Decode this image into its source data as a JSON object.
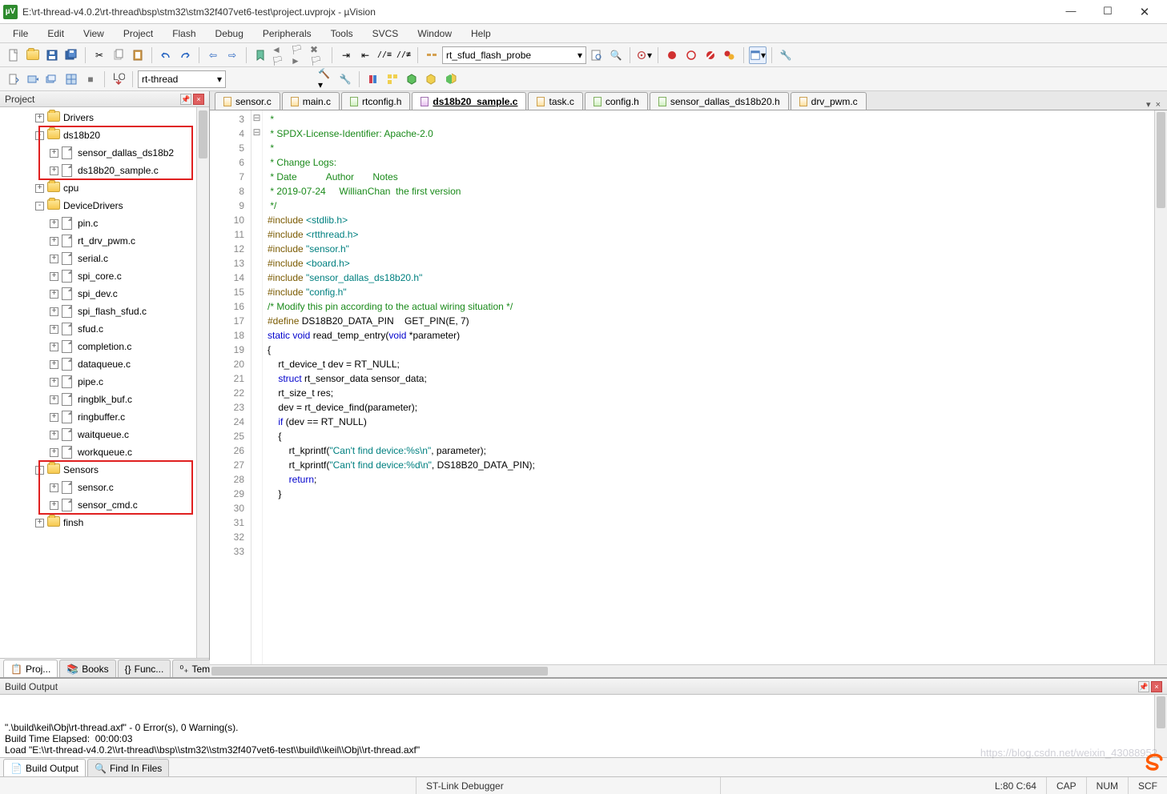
{
  "window": {
    "title": "E:\\rt-thread-v4.0.2\\rt-thread\\bsp\\stm32\\stm32f407vet6-test\\project.uvprojx - µVision",
    "app_icon_label": "µV"
  },
  "menu": [
    "File",
    "Edit",
    "View",
    "Project",
    "Flash",
    "Debug",
    "Peripherals",
    "Tools",
    "SVCS",
    "Window",
    "Help"
  ],
  "toolbar1": {
    "combo": "rt_sfud_flash_probe"
  },
  "toolbar2": {
    "target_combo": "rt-thread"
  },
  "project_panel": {
    "title": "Project",
    "tree": [
      {
        "indent": 2,
        "type": "folder",
        "twist": "+",
        "label": "Drivers"
      },
      {
        "indent": 2,
        "type": "folder",
        "twist": "-",
        "label": "ds18b20",
        "hl": "g1"
      },
      {
        "indent": 3,
        "type": "file",
        "twist": "+",
        "label": "sensor_dallas_ds18b2",
        "hl": "g1"
      },
      {
        "indent": 3,
        "type": "file",
        "twist": "+",
        "label": "ds18b20_sample.c",
        "hl": "g1"
      },
      {
        "indent": 2,
        "type": "folder",
        "twist": "+",
        "label": "cpu"
      },
      {
        "indent": 2,
        "type": "folder",
        "twist": "-",
        "label": "DeviceDrivers"
      },
      {
        "indent": 3,
        "type": "file",
        "twist": "+",
        "label": "pin.c"
      },
      {
        "indent": 3,
        "type": "file",
        "twist": "+",
        "label": "rt_drv_pwm.c"
      },
      {
        "indent": 3,
        "type": "file",
        "twist": "+",
        "label": "serial.c"
      },
      {
        "indent": 3,
        "type": "file",
        "twist": "+",
        "label": "spi_core.c"
      },
      {
        "indent": 3,
        "type": "file",
        "twist": "+",
        "label": "spi_dev.c"
      },
      {
        "indent": 3,
        "type": "file",
        "twist": "+",
        "label": "spi_flash_sfud.c"
      },
      {
        "indent": 3,
        "type": "file",
        "twist": "+",
        "label": "sfud.c"
      },
      {
        "indent": 3,
        "type": "file",
        "twist": "+",
        "label": "completion.c"
      },
      {
        "indent": 3,
        "type": "file",
        "twist": "+",
        "label": "dataqueue.c"
      },
      {
        "indent": 3,
        "type": "file",
        "twist": "+",
        "label": "pipe.c"
      },
      {
        "indent": 3,
        "type": "file",
        "twist": "+",
        "label": "ringblk_buf.c"
      },
      {
        "indent": 3,
        "type": "file",
        "twist": "+",
        "label": "ringbuffer.c"
      },
      {
        "indent": 3,
        "type": "file",
        "twist": "+",
        "label": "waitqueue.c"
      },
      {
        "indent": 3,
        "type": "file",
        "twist": "+",
        "label": "workqueue.c"
      },
      {
        "indent": 2,
        "type": "folder",
        "twist": "-",
        "label": "Sensors",
        "hl": "g2"
      },
      {
        "indent": 3,
        "type": "file",
        "twist": "+",
        "label": "sensor.c",
        "hl": "g2"
      },
      {
        "indent": 3,
        "type": "file",
        "twist": "+",
        "label": "sensor_cmd.c",
        "hl": "g2"
      },
      {
        "indent": 2,
        "type": "folder",
        "twist": "+",
        "label": "finsh"
      }
    ],
    "bottom_tabs": [
      {
        "label": "Proj...",
        "active": true,
        "icon": "project"
      },
      {
        "label": "Books",
        "active": false,
        "icon": "books"
      },
      {
        "label": "Func...",
        "active": false,
        "icon": "func"
      },
      {
        "label": "Tem...",
        "active": false,
        "icon": "tmpl"
      }
    ]
  },
  "editor_tabs": [
    {
      "label": "sensor.c",
      "cls": "c"
    },
    {
      "label": "main.c",
      "cls": "c"
    },
    {
      "label": "rtconfig.h",
      "cls": "h"
    },
    {
      "label": "ds18b20_sample.c",
      "cls": "sel",
      "active": true
    },
    {
      "label": "task.c",
      "cls": "c"
    },
    {
      "label": "config.h",
      "cls": "h"
    },
    {
      "label": "sensor_dallas_ds18b20.h",
      "cls": "h"
    },
    {
      "label": "drv_pwm.c",
      "cls": "c"
    }
  ],
  "code": {
    "first_line_no": 3,
    "lines": [
      {
        "t": " *",
        "cls": "c-com"
      },
      {
        "t": " * SPDX-License-Identifier: Apache-2.0",
        "cls": "c-com"
      },
      {
        "t": " *",
        "cls": "c-com"
      },
      {
        "t": " * Change Logs:",
        "cls": "c-com"
      },
      {
        "t": " * Date           Author       Notes",
        "cls": "c-com"
      },
      {
        "t": " * 2019-07-24     WillianChan  the first version",
        "cls": "c-com"
      },
      {
        "t": " */",
        "cls": "c-com"
      },
      {
        "t": "",
        "cls": ""
      },
      {
        "segs": [
          [
            "#include ",
            "c-pre"
          ],
          [
            "<stdlib.h>",
            "c-str"
          ]
        ]
      },
      {
        "segs": [
          [
            "#include ",
            "c-pre"
          ],
          [
            "<rtthread.h>",
            "c-str"
          ]
        ]
      },
      {
        "segs": [
          [
            "#include ",
            "c-pre"
          ],
          [
            "\"sensor.h\"",
            "c-str"
          ]
        ]
      },
      {
        "segs": [
          [
            "#include ",
            "c-pre"
          ],
          [
            "<board.h>",
            "c-str"
          ]
        ]
      },
      {
        "segs": [
          [
            "#include ",
            "c-pre"
          ],
          [
            "\"sensor_dallas_ds18b20.h\"",
            "c-str"
          ]
        ]
      },
      {
        "segs": [
          [
            "#include ",
            "c-pre"
          ],
          [
            "\"config.h\"",
            "c-str"
          ]
        ]
      },
      {
        "t": "",
        "cls": ""
      },
      {
        "t": "/* Modify this pin according to the actual wiring situation */",
        "cls": "c-com"
      },
      {
        "segs": [
          [
            "#define",
            "c-pre"
          ],
          [
            " DS18B20_DATA_PIN    GET_PIN(E, 7)",
            ""
          ]
        ]
      },
      {
        "t": "",
        "cls": ""
      },
      {
        "segs": [
          [
            "static void",
            "c-kw"
          ],
          [
            " read_temp_entry(",
            ""
          ],
          [
            "void",
            "c-kw"
          ],
          [
            " *parameter)",
            ""
          ]
        ]
      },
      {
        "t": "{",
        "fold": "-"
      },
      {
        "t": "    rt_device_t dev = RT_NULL;"
      },
      {
        "segs": [
          [
            "    ",
            ""
          ],
          [
            "struct",
            "c-kw"
          ],
          [
            " rt_sensor_data sensor_data;",
            ""
          ]
        ]
      },
      {
        "t": "    rt_size_t res;"
      },
      {
        "t": ""
      },
      {
        "t": "    dev = rt_device_find(parameter);"
      },
      {
        "segs": [
          [
            "    ",
            ""
          ],
          [
            "if",
            "c-kw"
          ],
          [
            " (dev == RT_NULL)",
            ""
          ]
        ]
      },
      {
        "t": "    {",
        "fold": "-"
      },
      {
        "segs": [
          [
            "        rt_kprintf(",
            ""
          ],
          [
            "\"Can't find device:%s\\n\"",
            "c-str"
          ],
          [
            ", parameter);",
            ""
          ]
        ]
      },
      {
        "segs": [
          [
            "        rt_kprintf(",
            ""
          ],
          [
            "\"Can't find device:%d\\n\"",
            "c-str"
          ],
          [
            ", DS18B20_DATA_PIN);",
            ""
          ]
        ]
      },
      {
        "segs": [
          [
            "        ",
            ""
          ],
          [
            "return",
            "c-kw"
          ],
          [
            ";",
            ""
          ]
        ]
      },
      {
        "t": "    }"
      }
    ]
  },
  "build_output": {
    "title": "Build Output",
    "lines": [
      "\".\\build\\keil\\Obj\\rt-thread.axf\" - 0 Error(s), 0 Warning(s).",
      "Build Time Elapsed:  00:00:03",
      "Load \"E:\\\\rt-thread-v4.0.2\\\\rt-thread\\\\bsp\\\\stm32\\\\stm32f407vet6-test\\\\build\\\\keil\\\\Obj\\\\rt-thread.axf\""
    ],
    "bottom_tabs": [
      {
        "label": "Build Output",
        "active": true
      },
      {
        "label": "Find In Files",
        "active": false
      }
    ]
  },
  "status": {
    "debugger": "ST-Link Debugger",
    "cursor": "L:80 C:64",
    "caps": "CAP",
    "num": "NUM",
    "scf": "SCF"
  },
  "watermark": "https://blog.csdn.net/weixin_43088952"
}
